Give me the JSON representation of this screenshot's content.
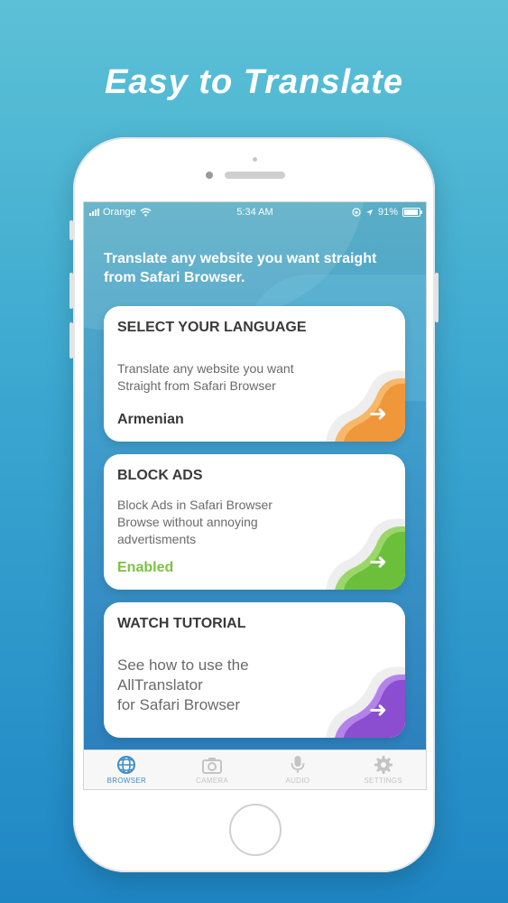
{
  "headline": "Easy to Translate",
  "status_bar": {
    "carrier": "Orange",
    "time": "5:34 AM",
    "battery": "91%"
  },
  "intro": "Translate any website you want straight from Safari Browser.",
  "cards": [
    {
      "title": "SELECT YOUR LANGUAGE",
      "desc": [
        "Translate any website you want",
        "Straight from Safari Browser"
      ],
      "status": "Armenian",
      "status_color": "#3a3a3a",
      "accent": "#f0973a",
      "accent_light": "#f8b86a"
    },
    {
      "title": "BLOCK ADS",
      "desc": [
        "Block Ads in Safari Browser",
        "Browse without annoying",
        "advertisments"
      ],
      "status": "Enabled",
      "status_color": "#7cc242",
      "accent": "#6cbf3a",
      "accent_light": "#9bd66a"
    },
    {
      "title": "WATCH TUTORIAL",
      "desc": [
        "See how to use the",
        "AllTranslator",
        "for Safari Browser"
      ],
      "accent": "#8b4ed0",
      "accent_light": "#b383ea"
    }
  ],
  "tabs": [
    {
      "label": "BROWSER",
      "icon": "globe-icon",
      "color": "#3d8fc6"
    },
    {
      "label": "CAMERA",
      "icon": "camera-icon",
      "color": "#c4c4c4"
    },
    {
      "label": "AUDIO",
      "icon": "microphone-icon",
      "color": "#c4c4c4"
    },
    {
      "label": "SETTINGS",
      "icon": "gear-icon",
      "color": "#c4c4c4"
    }
  ]
}
